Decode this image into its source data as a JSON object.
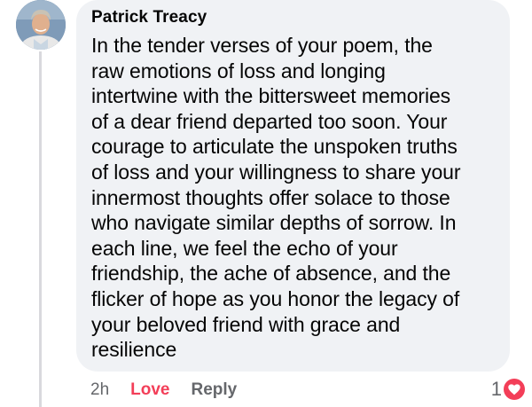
{
  "comment": {
    "author": "Patrick Treacy",
    "lines": [
      "In the tender verses of your poem, the",
      "raw emotions of loss and longing",
      "intertwine with the bittersweet memories",
      "of a dear friend departed too soon.  Your",
      "courage to articulate the unspoken truths",
      "of loss and your willingness to share your",
      "innermost thoughts offer solace to those",
      "who navigate similar depths of sorrow. In",
      "each line, we feel the echo of your",
      "friendship, the ache of absence, and the",
      "flicker of hope as you honor the legacy of",
      "your beloved friend with grace and",
      "resilience"
    ],
    "time": "2h",
    "love_label": "Love",
    "reply_label": "Reply",
    "reaction_count": "1",
    "reaction_icon": "heart-icon",
    "colors": {
      "bubble": "#f0f2f5",
      "love": "#f33e58",
      "muted": "#65676b",
      "text": "#050505"
    }
  }
}
